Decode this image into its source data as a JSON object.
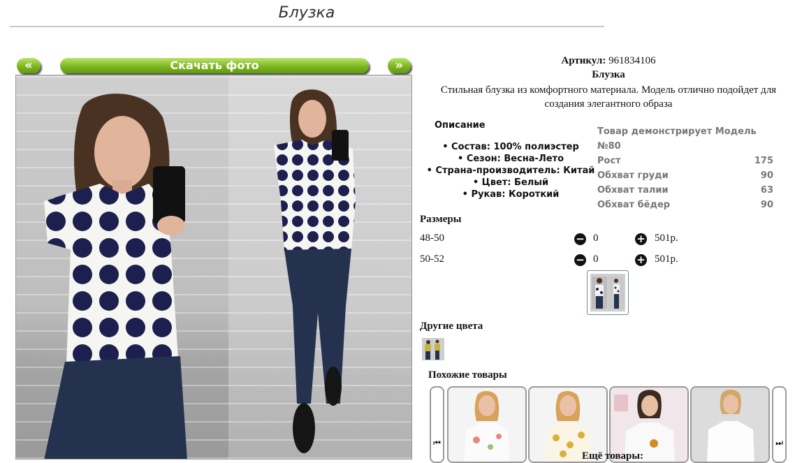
{
  "product": {
    "title": "Блузка",
    "sku_label": "Артикул:",
    "sku_value": "961834106",
    "name": "Блузка",
    "description": "Стильная блузка из комфортного материала. Модель отлично подойдет для создания элегантного образа"
  },
  "gallery": {
    "prev_label": "«",
    "next_label": "»",
    "download_label": "Скачать фото"
  },
  "details": {
    "heading": "Описание",
    "features": [
      "Состав: 100% полиэстер",
      "Сезон: Весна-Лето",
      "Страна-производитель: Китай",
      "Цвет: Белый",
      "Рукав: Короткий"
    ]
  },
  "model": {
    "heading": "Товар демонстрирует Модель №80",
    "rows": [
      {
        "label": "Рост",
        "value": "175"
      },
      {
        "label": "Обхват груди",
        "value": "90"
      },
      {
        "label": "Обхват талии",
        "value": "63"
      },
      {
        "label": "Обхват бёдер",
        "value": "90"
      }
    ]
  },
  "sizes": {
    "heading": "Размеры",
    "minus_icon": "−",
    "plus_icon": "+",
    "rows": [
      {
        "size": "48-50",
        "qty": "0",
        "price": "501р."
      },
      {
        "size": "50-52",
        "qty": "0",
        "price": "501р."
      }
    ]
  },
  "other_colors": {
    "heading": "Другие цвета"
  },
  "similar": {
    "heading": "Похожие товары",
    "prev_icon": "⏮",
    "next_icon": "⏭",
    "more_label": "Ещё товары:"
  },
  "colors": {
    "accent_green": "#7fb51f",
    "polka_navy": "#1d1f4f"
  }
}
